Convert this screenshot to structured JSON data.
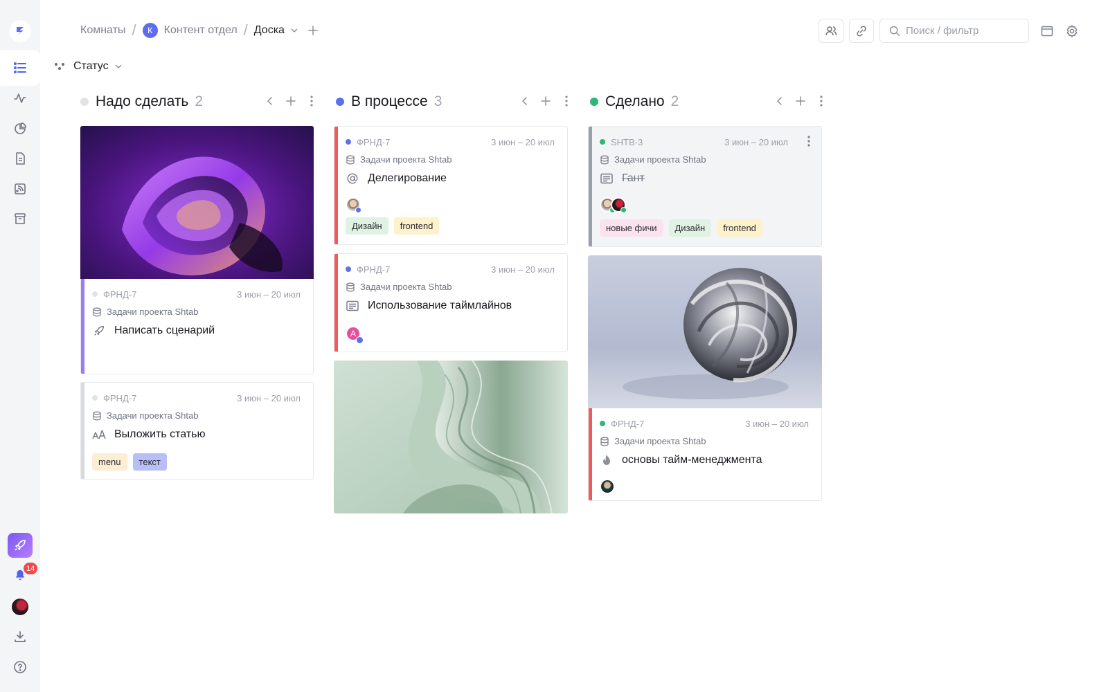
{
  "breadcrumb": {
    "rooms": "Комнаты",
    "room_initial": "К",
    "room": "Контент отдел",
    "current": "Доска"
  },
  "search": {
    "placeholder": "Поиск / фильтр"
  },
  "groupby": {
    "label": "Статус"
  },
  "sidebar": {
    "notifications_count": "14"
  },
  "columns": [
    {
      "title": "Надо сделать",
      "count": "2",
      "color": "#e2e3e6"
    },
    {
      "title": "В процессе",
      "count": "3",
      "color": "#5b71ee"
    },
    {
      "title": "Сделано",
      "count": "2",
      "color": "#2fb67a"
    }
  ],
  "cards": {
    "todo_1": {
      "id": "ФРНД-7",
      "date": "3 июн – 20 июл",
      "project": "Задачи проекта Shtab",
      "title": "Написать сценарий",
      "bar_color": "#9b7bf7"
    },
    "todo_2": {
      "id": "ФРНД-7",
      "date": "3 июн – 20 июл",
      "project": "Задачи проекта Shtab",
      "title": "Выложить статью",
      "tags": [
        "menu",
        "текст"
      ],
      "bar_color": "#d7d9de"
    },
    "prog_1": {
      "id": "ФРНД-7",
      "date": "3 июн – 20 июл",
      "project": "Задачи проекта Shtab",
      "title": "Делегирование",
      "tags": [
        "Дизайн",
        "frontend"
      ],
      "bar_color": "#ef5a5a"
    },
    "prog_2": {
      "id": "ФРНД-7",
      "date": "3 июн – 20 июл",
      "project": "Задачи проекта Shtab",
      "title": "Использование таймлайнов",
      "avatar_initial": "А",
      "bar_color": "#ef5a5a"
    },
    "done_1": {
      "id": "SHTB-3",
      "date": "3 июн – 20 июл",
      "project": "Задачи проекта Shtab",
      "title": "Гант",
      "tags": [
        "новые фичи",
        "Дизайн",
        "frontend"
      ],
      "bar_color": "#9aa0aa"
    },
    "done_2": {
      "id": "ФРНД-7",
      "date": "3 июн – 20 июл",
      "project": "Задачи проекта Shtab",
      "title": "основы тайм-менеджмента",
      "bar_color": "#ef5a5a"
    }
  },
  "tag_colors": {
    "menu": "#fbeed3",
    "текст": "#b7bff6",
    "Дизайн": "#dff2e3",
    "frontend": "#fdf2cc",
    "новые фичи": "#fbe3ee"
  }
}
